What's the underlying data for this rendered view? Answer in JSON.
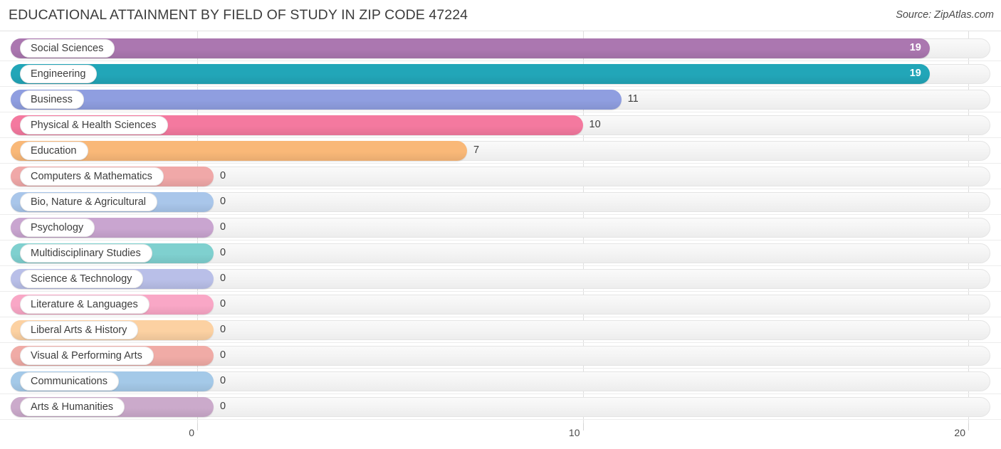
{
  "header": {
    "title": "EDUCATIONAL ATTAINMENT BY FIELD OF STUDY IN ZIP CODE 47224",
    "source": "Source: ZipAtlas.com"
  },
  "chart_data": {
    "type": "bar",
    "orientation": "horizontal",
    "title": "EDUCATIONAL ATTAINMENT BY FIELD OF STUDY IN ZIP CODE 47224",
    "xlabel": "",
    "ylabel": "",
    "xlim": [
      0,
      20
    ],
    "xticks": [
      0,
      10,
      20
    ],
    "xtick_labels": [
      "0",
      "10",
      "20"
    ],
    "grid": true,
    "legend": "none",
    "categories": [
      "Social Sciences",
      "Engineering",
      "Business",
      "Physical & Health Sciences",
      "Education",
      "Computers & Mathematics",
      "Bio, Nature & Agricultural",
      "Psychology",
      "Multidisciplinary Studies",
      "Science & Technology",
      "Literature & Languages",
      "Liberal Arts & History",
      "Visual & Performing Arts",
      "Communications",
      "Arts & Humanities"
    ],
    "values": [
      19,
      19,
      11,
      10,
      7,
      0,
      0,
      0,
      0,
      0,
      0,
      0,
      0,
      0,
      0
    ],
    "value_labels": [
      "19",
      "19",
      "11",
      "10",
      "7",
      "0",
      "0",
      "0",
      "0",
      "0",
      "0",
      "0",
      "0",
      "0",
      "0"
    ],
    "colors": [
      "#ab77b0",
      "#22a6b8",
      "#8f9ee0",
      "#f4799f",
      "#f9b878",
      "#f0a8a8",
      "#a9c6ea",
      "#c9a5d0",
      "#7fd0cf",
      "#b9bfe8",
      "#f9a7c6",
      "#fcd1a2",
      "#f0aba6",
      "#a4c9e8",
      "#cbaacb"
    ]
  },
  "rows": [
    {
      "label": "Social Sciences",
      "value": 19,
      "value_text": "19",
      "color": "#ab77b0",
      "inside": true
    },
    {
      "label": "Engineering",
      "value": 19,
      "value_text": "19",
      "color": "#22a6b8",
      "inside": true
    },
    {
      "label": "Business",
      "value": 11,
      "value_text": "11",
      "color": "#8f9ee0",
      "inside": false
    },
    {
      "label": "Physical & Health Sciences",
      "value": 10,
      "value_text": "10",
      "color": "#f4799f",
      "inside": false
    },
    {
      "label": "Education",
      "value": 7,
      "value_text": "7",
      "color": "#f9b878",
      "inside": false
    },
    {
      "label": "Computers & Mathematics",
      "value": 0,
      "value_text": "0",
      "color": "#f0a8a8",
      "inside": false
    },
    {
      "label": "Bio, Nature & Agricultural",
      "value": 0,
      "value_text": "0",
      "color": "#a9c6ea",
      "inside": false
    },
    {
      "label": "Psychology",
      "value": 0,
      "value_text": "0",
      "color": "#c9a5d0",
      "inside": false
    },
    {
      "label": "Multidisciplinary Studies",
      "value": 0,
      "value_text": "0",
      "color": "#7fd0cf",
      "inside": false
    },
    {
      "label": "Science & Technology",
      "value": 0,
      "value_text": "0",
      "color": "#b9bfe8",
      "inside": false
    },
    {
      "label": "Literature & Languages",
      "value": 0,
      "value_text": "0",
      "color": "#f9a7c6",
      "inside": false
    },
    {
      "label": "Liberal Arts & History",
      "value": 0,
      "value_text": "0",
      "color": "#fcd1a2",
      "inside": false
    },
    {
      "label": "Visual & Performing Arts",
      "value": 0,
      "value_text": "0",
      "color": "#f0aba6",
      "inside": false
    },
    {
      "label": "Communications",
      "value": 0,
      "value_text": "0",
      "color": "#a4c9e8",
      "inside": false
    },
    {
      "label": "Arts & Humanities",
      "value": 0,
      "value_text": "0",
      "color": "#cbaacb",
      "inside": false
    }
  ],
  "axis": {
    "ticks": [
      {
        "label": "0",
        "value": 0
      },
      {
        "label": "10",
        "value": 10
      },
      {
        "label": "20",
        "value": 20
      }
    ]
  }
}
